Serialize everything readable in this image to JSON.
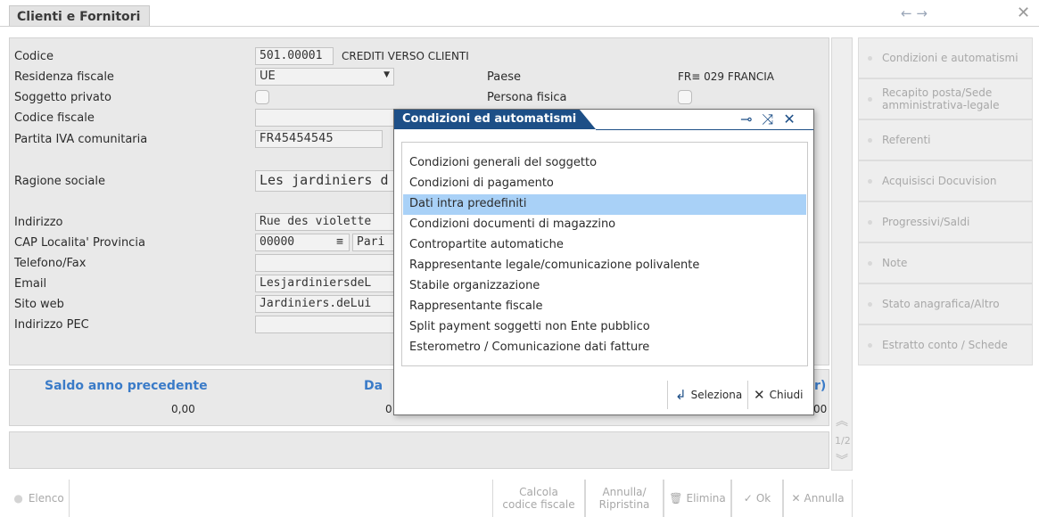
{
  "window": {
    "title": "Clienti e Fornitori",
    "nav_arrows": "← →",
    "close_glyph": "✕"
  },
  "form": {
    "codice_label": "Codice",
    "codice_value": "501.00001",
    "codice_desc": "CREDITI VERSO CLIENTI",
    "residenza_label": "Residenza fiscale",
    "residenza_value": "UE",
    "paese_label": "Paese",
    "paese_code": "FR",
    "paese_num": "029",
    "paese_name": "FRANCIA",
    "soggetto_privato_label": "Soggetto privato",
    "persona_fisica_label": "Persona fisica",
    "codice_fiscale_label": "Codice fiscale",
    "codice_fiscale_value": "",
    "partita_iva_label": "Partita IVA comunitaria",
    "partita_iva_value": "FR45454545",
    "ragione_sociale_label": "Ragione sociale",
    "ragione_sociale_value": "Les jardiniers d",
    "indirizzo_label": "Indirizzo",
    "indirizzo_value": "Rue des violette",
    "cap_label": "CAP Localita' Provincia",
    "cap_value": "00000",
    "localita_value": "Pari",
    "telefono_label": "Telefono/Fax",
    "telefono_value": "",
    "email_label": "Email",
    "email_value": "LesjardiniersdeL",
    "sito_label": "Sito web",
    "sito_value": "Jardiniers.deLui",
    "pec_label": "Indirizzo PEC",
    "pec_value": ""
  },
  "saldo": {
    "head1": "Saldo anno precedente",
    "value1": "0,00",
    "head2": "Da",
    "value2": "0",
    "head3": "r)",
    "value3": "00"
  },
  "scroll": {
    "page": "1/2"
  },
  "sidebar": {
    "items": [
      {
        "label": "Condizioni e automatismi"
      },
      {
        "label": "Recapito posta/Sede amministrativa-legale"
      },
      {
        "label": "Referenti"
      },
      {
        "label": "Acquisisci Docuvision"
      },
      {
        "label": "Progressivi/Saldi"
      },
      {
        "label": "Note"
      },
      {
        "label": "Stato anagrafica/Altro"
      },
      {
        "label": "Estratto conto / Schede"
      }
    ]
  },
  "toolbar": {
    "elenco": "Elenco",
    "calcola_cf": "Calcola codice fiscale",
    "annulla_ripristina": "Annulla/ Ripristina",
    "elimina": "Elimina",
    "ok": "Ok",
    "annulla": "Annulla"
  },
  "dialog": {
    "title": "Condizioni ed automatismi",
    "items": [
      {
        "label": "Condizioni generali del soggetto"
      },
      {
        "label": "Condizioni di pagamento"
      },
      {
        "label": "Dati intra predefiniti"
      },
      {
        "label": "Condizioni documenti di magazzino"
      },
      {
        "label": "Contropartite automatiche"
      },
      {
        "label": "Rappresentante legale/comunicazione polivalente"
      },
      {
        "label": "Stabile organizzazione"
      },
      {
        "label": "Rappresentante fiscale"
      },
      {
        "label": "Split payment soggetti non Ente pubblico"
      },
      {
        "label": "Esterometro / Comunicazione dati fatture"
      }
    ],
    "selected_index": 2,
    "seleziona_label": "Seleziona",
    "chiudi_label": "Chiudi"
  },
  "colors": {
    "dialog_title_bg": "#1d4f87",
    "selection_bg": "#a9d1f7",
    "saldo_heading": "#3a7bc8"
  }
}
